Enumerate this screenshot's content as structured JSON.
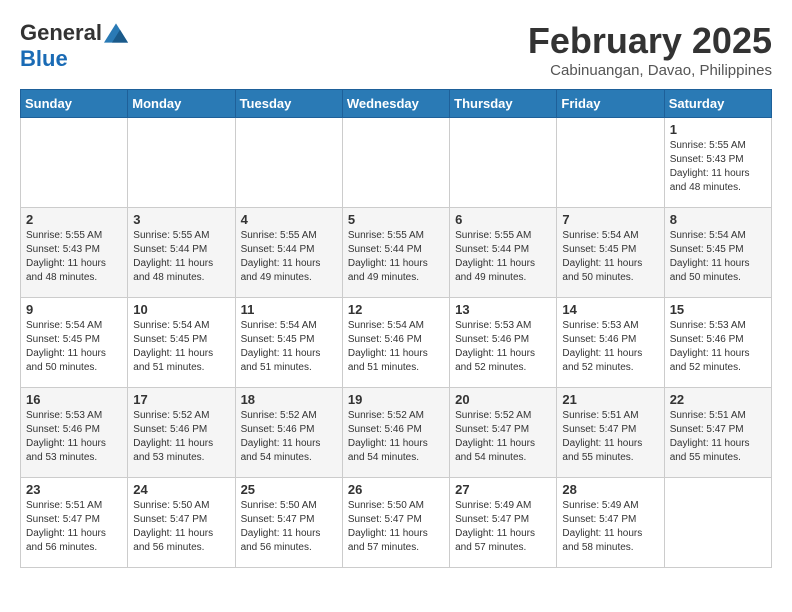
{
  "header": {
    "logo_general": "General",
    "logo_blue": "Blue",
    "month_year": "February 2025",
    "location": "Cabinuangan, Davao, Philippines"
  },
  "calendar": {
    "days_of_week": [
      "Sunday",
      "Monday",
      "Tuesday",
      "Wednesday",
      "Thursday",
      "Friday",
      "Saturday"
    ],
    "weeks": [
      [
        {
          "day": "",
          "info": ""
        },
        {
          "day": "",
          "info": ""
        },
        {
          "day": "",
          "info": ""
        },
        {
          "day": "",
          "info": ""
        },
        {
          "day": "",
          "info": ""
        },
        {
          "day": "",
          "info": ""
        },
        {
          "day": "1",
          "info": "Sunrise: 5:55 AM\nSunset: 5:43 PM\nDaylight: 11 hours\nand 48 minutes."
        }
      ],
      [
        {
          "day": "2",
          "info": "Sunrise: 5:55 AM\nSunset: 5:43 PM\nDaylight: 11 hours\nand 48 minutes."
        },
        {
          "day": "3",
          "info": "Sunrise: 5:55 AM\nSunset: 5:44 PM\nDaylight: 11 hours\nand 48 minutes."
        },
        {
          "day": "4",
          "info": "Sunrise: 5:55 AM\nSunset: 5:44 PM\nDaylight: 11 hours\nand 49 minutes."
        },
        {
          "day": "5",
          "info": "Sunrise: 5:55 AM\nSunset: 5:44 PM\nDaylight: 11 hours\nand 49 minutes."
        },
        {
          "day": "6",
          "info": "Sunrise: 5:55 AM\nSunset: 5:44 PM\nDaylight: 11 hours\nand 49 minutes."
        },
        {
          "day": "7",
          "info": "Sunrise: 5:54 AM\nSunset: 5:45 PM\nDaylight: 11 hours\nand 50 minutes."
        },
        {
          "day": "8",
          "info": "Sunrise: 5:54 AM\nSunset: 5:45 PM\nDaylight: 11 hours\nand 50 minutes."
        }
      ],
      [
        {
          "day": "9",
          "info": "Sunrise: 5:54 AM\nSunset: 5:45 PM\nDaylight: 11 hours\nand 50 minutes."
        },
        {
          "day": "10",
          "info": "Sunrise: 5:54 AM\nSunset: 5:45 PM\nDaylight: 11 hours\nand 51 minutes."
        },
        {
          "day": "11",
          "info": "Sunrise: 5:54 AM\nSunset: 5:45 PM\nDaylight: 11 hours\nand 51 minutes."
        },
        {
          "day": "12",
          "info": "Sunrise: 5:54 AM\nSunset: 5:46 PM\nDaylight: 11 hours\nand 51 minutes."
        },
        {
          "day": "13",
          "info": "Sunrise: 5:53 AM\nSunset: 5:46 PM\nDaylight: 11 hours\nand 52 minutes."
        },
        {
          "day": "14",
          "info": "Sunrise: 5:53 AM\nSunset: 5:46 PM\nDaylight: 11 hours\nand 52 minutes."
        },
        {
          "day": "15",
          "info": "Sunrise: 5:53 AM\nSunset: 5:46 PM\nDaylight: 11 hours\nand 52 minutes."
        }
      ],
      [
        {
          "day": "16",
          "info": "Sunrise: 5:53 AM\nSunset: 5:46 PM\nDaylight: 11 hours\nand 53 minutes."
        },
        {
          "day": "17",
          "info": "Sunrise: 5:52 AM\nSunset: 5:46 PM\nDaylight: 11 hours\nand 53 minutes."
        },
        {
          "day": "18",
          "info": "Sunrise: 5:52 AM\nSunset: 5:46 PM\nDaylight: 11 hours\nand 54 minutes."
        },
        {
          "day": "19",
          "info": "Sunrise: 5:52 AM\nSunset: 5:46 PM\nDaylight: 11 hours\nand 54 minutes."
        },
        {
          "day": "20",
          "info": "Sunrise: 5:52 AM\nSunset: 5:47 PM\nDaylight: 11 hours\nand 54 minutes."
        },
        {
          "day": "21",
          "info": "Sunrise: 5:51 AM\nSunset: 5:47 PM\nDaylight: 11 hours\nand 55 minutes."
        },
        {
          "day": "22",
          "info": "Sunrise: 5:51 AM\nSunset: 5:47 PM\nDaylight: 11 hours\nand 55 minutes."
        }
      ],
      [
        {
          "day": "23",
          "info": "Sunrise: 5:51 AM\nSunset: 5:47 PM\nDaylight: 11 hours\nand 56 minutes."
        },
        {
          "day": "24",
          "info": "Sunrise: 5:50 AM\nSunset: 5:47 PM\nDaylight: 11 hours\nand 56 minutes."
        },
        {
          "day": "25",
          "info": "Sunrise: 5:50 AM\nSunset: 5:47 PM\nDaylight: 11 hours\nand 56 minutes."
        },
        {
          "day": "26",
          "info": "Sunrise: 5:50 AM\nSunset: 5:47 PM\nDaylight: 11 hours\nand 57 minutes."
        },
        {
          "day": "27",
          "info": "Sunrise: 5:49 AM\nSunset: 5:47 PM\nDaylight: 11 hours\nand 57 minutes."
        },
        {
          "day": "28",
          "info": "Sunrise: 5:49 AM\nSunset: 5:47 PM\nDaylight: 11 hours\nand 58 minutes."
        },
        {
          "day": "",
          "info": ""
        }
      ]
    ]
  }
}
